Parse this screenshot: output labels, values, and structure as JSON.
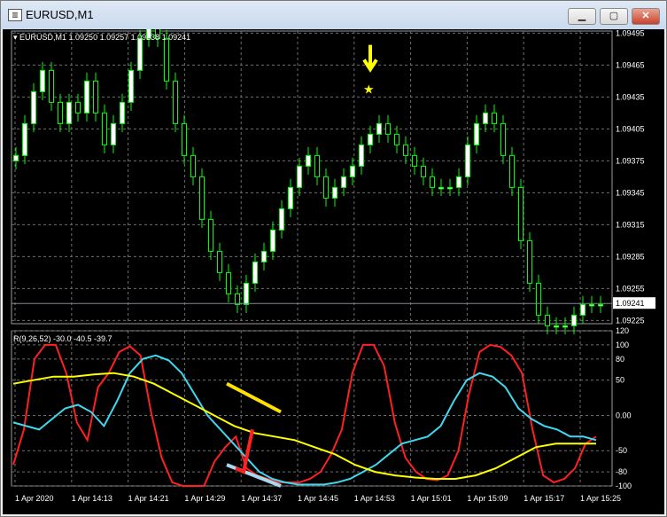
{
  "window": {
    "title": "EURUSD,M1",
    "icon": "chart-window-icon",
    "controls": {
      "minimize": "minimize-icon",
      "maximize": "maximize-icon",
      "close": "close-icon"
    }
  },
  "price_panel": {
    "header": "EURUSD,M1  1.09250 1.09257 1.09238 1.09241",
    "current_price": "1.09241",
    "annotations": {
      "arrow": "down-arrow-icon",
      "star": "star-icon",
      "color": "#ffff00"
    }
  },
  "indicator_panel": {
    "header": "R(9,26,52) -30.0 -40.5 -39.7"
  },
  "colors": {
    "background": "#000000",
    "grid": "#6e6e6e",
    "fast": "#ff2020",
    "mid": "#40d8f0",
    "slow": "#ffff00",
    "candle": "#00ff00",
    "bull_body": "#ffffff"
  },
  "chart_data": [
    {
      "type": "candlestick",
      "title": "EURUSD,M1",
      "ylim": [
        1.09222,
        1.09497
      ],
      "y_ticks": [
        "1.09495",
        "1.09465",
        "1.09435",
        "1.09405",
        "1.09375",
        "1.09345",
        "1.09315",
        "1.09285",
        "1.09255",
        "1.09225"
      ],
      "x_ticks": [
        "1 Apr 2020",
        "1 Apr 14:13",
        "1 Apr 14:21",
        "1 Apr 14:29",
        "1 Apr 14:37",
        "1 Apr 14:45",
        "1 Apr 14:53",
        "1 Apr 15:01",
        "1 Apr 15:09",
        "1 Apr 15:17",
        "1 Apr 15:25"
      ],
      "close": [
        1.0938,
        1.0941,
        1.0944,
        1.0946,
        1.0943,
        1.0941,
        1.0943,
        1.0942,
        1.0945,
        1.0942,
        1.0939,
        1.0941,
        1.0943,
        1.0946,
        1.0949,
        1.0951,
        1.0949,
        1.0945,
        1.0941,
        1.0938,
        1.0936,
        1.0932,
        1.0929,
        1.0927,
        1.0925,
        1.0924,
        1.0926,
        1.0928,
        1.0929,
        1.0931,
        1.0933,
        1.0935,
        1.0937,
        1.0938,
        1.0936,
        1.0934,
        1.0935,
        1.0936,
        1.0937,
        1.0939,
        1.094,
        1.0941,
        1.094,
        1.0939,
        1.0938,
        1.0937,
        1.0936,
        1.0935,
        1.0935,
        1.0935,
        1.0936,
        1.0939,
        1.0941,
        1.0942,
        1.0941,
        1.0938,
        1.0935,
        1.093,
        1.0926,
        1.0923,
        1.0922,
        1.0922,
        1.0922,
        1.0923,
        1.0924,
        1.0924,
        1.0924
      ],
      "last": 1.09241
    },
    {
      "type": "line",
      "title": "R(9,26,52)",
      "ylim": [
        -100,
        120
      ],
      "y_ticks": [
        "120",
        "100",
        "80",
        "50",
        "0.00",
        "-50",
        "-80",
        "-100"
      ],
      "x_ticks": [
        "1 Apr 2020",
        "1 Apr 14:13",
        "1 Apr 14:21",
        "1 Apr 14:29",
        "1 Apr 14:37",
        "1 Apr 14:45",
        "1 Apr 14:53",
        "1 Apr 15:01",
        "1 Apr 15:09",
        "1 Apr 15:17",
        "1 Apr 15:25"
      ],
      "series": [
        {
          "name": "R(9)",
          "color": "#ff2020",
          "values": [
            -70,
            -20,
            80,
            100,
            100,
            60,
            -10,
            -35,
            40,
            60,
            90,
            98,
            85,
            5,
            -60,
            -95,
            -100,
            -100,
            -100,
            -65,
            -45,
            -30,
            -75,
            -85,
            -90,
            -95,
            -95,
            -95,
            -90,
            -80,
            -55,
            -20,
            60,
            100,
            100,
            70,
            -10,
            -60,
            -80,
            -90,
            -92,
            -85,
            -50,
            30,
            90,
            100,
            97,
            85,
            60,
            -20,
            -85,
            -95,
            -90,
            -75,
            -40,
            -30
          ]
        },
        {
          "name": "R(26)",
          "color": "#40d8f0",
          "values": [
            -10,
            -15,
            -20,
            -5,
            10,
            15,
            5,
            -15,
            20,
            60,
            80,
            85,
            78,
            60,
            30,
            0,
            -20,
            -40,
            -60,
            -80,
            -90,
            -95,
            -98,
            -98,
            -98,
            -95,
            -90,
            -80,
            -70,
            -55,
            -40,
            -35,
            -30,
            -15,
            20,
            50,
            60,
            55,
            40,
            10,
            -5,
            -15,
            -20,
            -30,
            -30,
            -35
          ]
        },
        {
          "name": "R(52)",
          "color": "#ffff00",
          "values": [
            45,
            50,
            55,
            55,
            58,
            60,
            55,
            45,
            30,
            15,
            0,
            -15,
            -25,
            -30,
            -35,
            -45,
            -55,
            -70,
            -80,
            -85,
            -88,
            -90,
            -90,
            -85,
            -75,
            -60,
            -45,
            -40,
            -40,
            -40
          ]
        }
      ]
    }
  ]
}
